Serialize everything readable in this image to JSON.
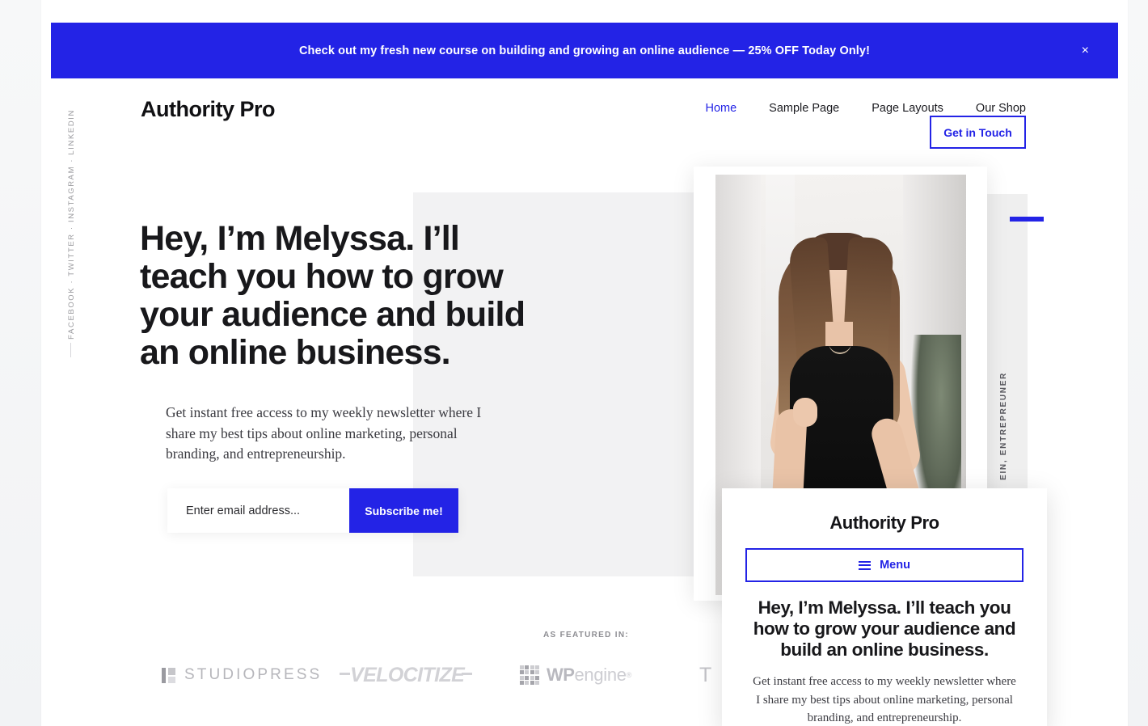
{
  "promo": {
    "text": "Check out my fresh new course on building and growing an online audience — 25% OFF Today Only!",
    "close_label": "×",
    "background_color": "#2323e6"
  },
  "social_rail": {
    "text": "FACEBOOK  ·  TWITTER  ·  INSTAGRAM  ·  LINKEDIN",
    "items": [
      "FACEBOOK",
      "TWITTER",
      "INSTAGRAM",
      "LINKEDIN"
    ]
  },
  "header": {
    "site_title": "Authority Pro",
    "nav": [
      {
        "label": "Home",
        "active": true
      },
      {
        "label": "Sample Page",
        "active": false
      },
      {
        "label": "Page Layouts",
        "active": false
      },
      {
        "label": "Our Shop",
        "active": false
      }
    ],
    "cta_label": "Get in Touch",
    "accent_color": "#2323e6"
  },
  "hero": {
    "headline": "Hey, I’m Melyssa. I’ll teach you how to grow your audience and build an online business.",
    "subtext": "Get instant free access to my weekly newsletter where I share my best tips about online marketing, personal branding, and entrepreneurship.",
    "email_placeholder": "Enter email address...",
    "email_value": "",
    "subscribe_label": "Subscribe me!",
    "vertical_tag": "EIN, ENTREPREUNER",
    "photo_alt": "Melyssa portrait photo"
  },
  "featured": {
    "label": "AS FEATURED IN:",
    "logos": [
      {
        "name": "studiopress",
        "text": "STUDIOPRESS"
      },
      {
        "name": "velocitize",
        "text": "VELOCITIZE"
      },
      {
        "name": "wpengine",
        "text_bold": "WP",
        "text_light": "engine",
        "mark": "®"
      },
      {
        "name": "fourth-cut-off",
        "text": "T C"
      }
    ]
  },
  "mobile_preview": {
    "title": "Authority Pro",
    "menu_label": "Menu",
    "headline": "Hey, I’m Melyssa. I’ll teach you how to grow your audience and build an online business.",
    "subtext": "Get instant free access to my weekly newsletter where I share my best tips about online marketing, personal branding, and entrepreneurship."
  }
}
